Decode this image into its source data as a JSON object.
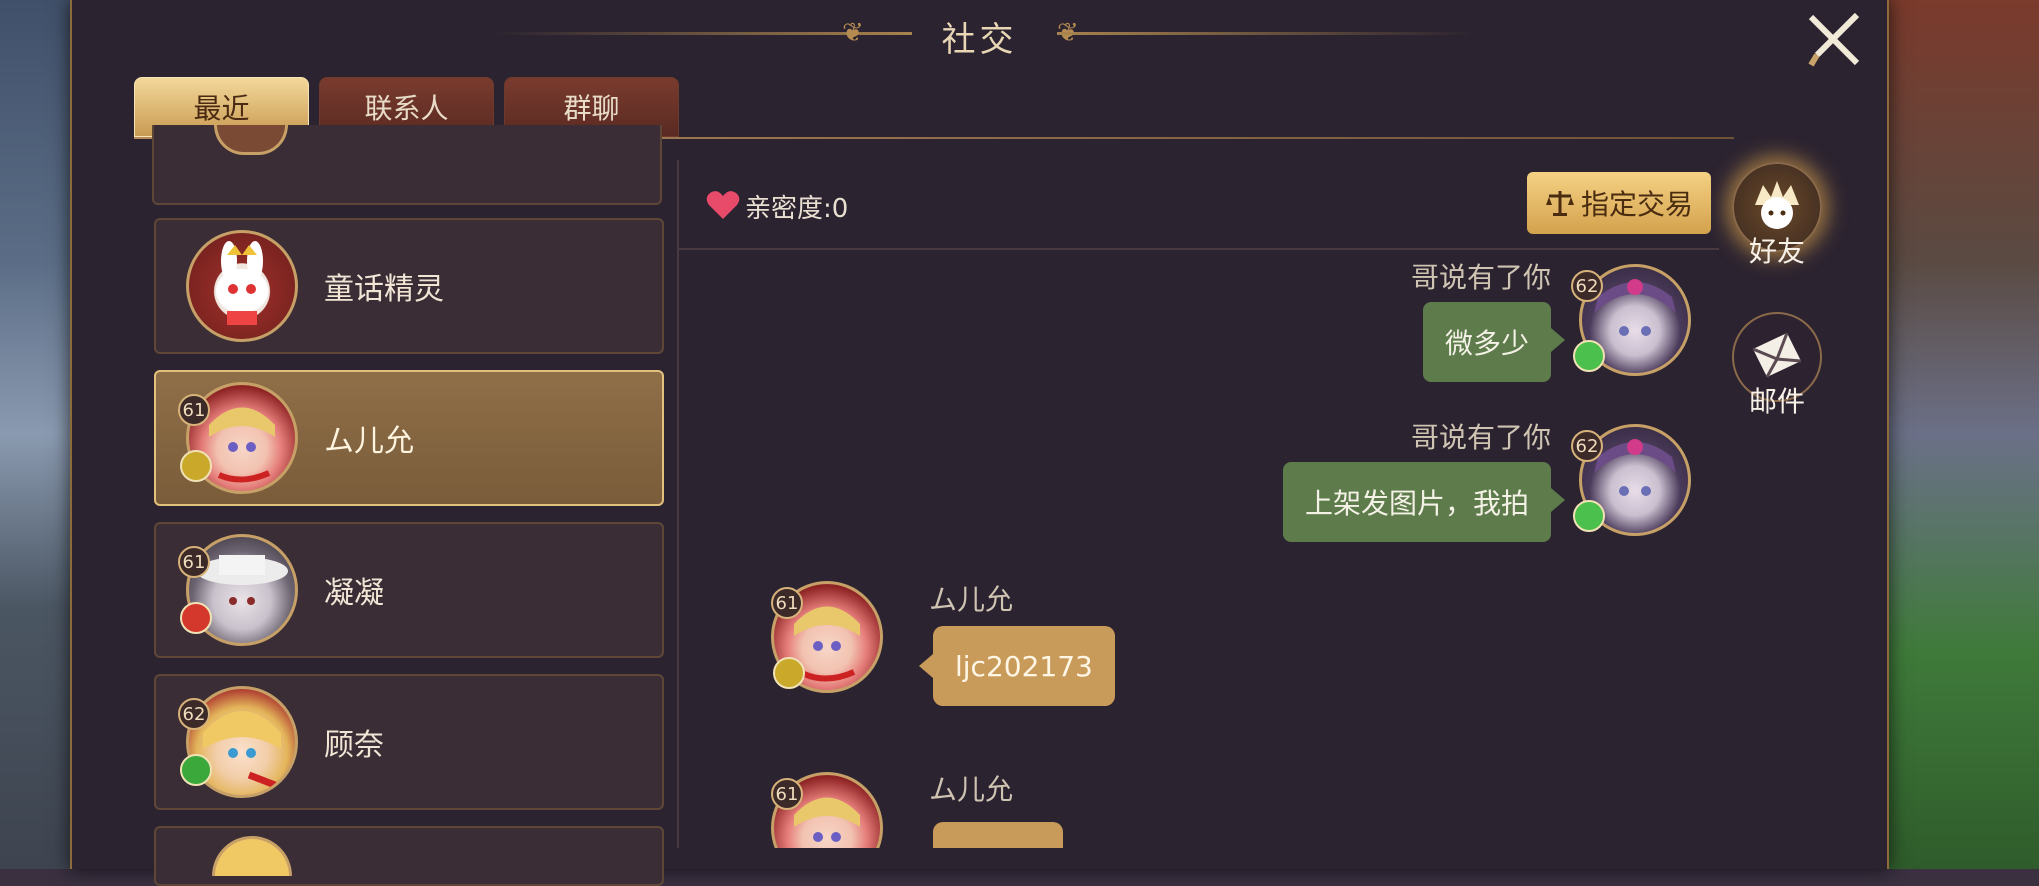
{
  "window": {
    "title": "社交"
  },
  "tabs": [
    {
      "label": "最近",
      "active": true
    },
    {
      "label": "联系人",
      "active": false
    },
    {
      "label": "群聊",
      "active": false
    }
  ],
  "contacts": [
    {
      "name": "",
      "level": "",
      "partial": true
    },
    {
      "name": "童话精灵",
      "level": ""
    },
    {
      "name": "ム儿允",
      "level": "61",
      "selected": true
    },
    {
      "name": "凝凝",
      "level": "61"
    },
    {
      "name": "顾奈",
      "level": "62"
    },
    {
      "name": "",
      "level": "",
      "partial": true
    }
  ],
  "chat": {
    "intimacy_label": "亲密度:0",
    "trade_button": "指定交易",
    "messages": [
      {
        "sender": "哥说有了你",
        "level": "62",
        "text": "微多少",
        "side": "right"
      },
      {
        "sender": "哥说有了你",
        "level": "62",
        "text": "上架发图片，我拍",
        "side": "right"
      },
      {
        "sender": "ム儿允",
        "level": "61",
        "text": "ljc202173",
        "side": "left"
      },
      {
        "sender": "ム儿允",
        "level": "61",
        "text": "",
        "side": "left"
      }
    ]
  },
  "side_nav": [
    {
      "label": "好友",
      "icon": "friend-icon",
      "active": true
    },
    {
      "label": "邮件",
      "icon": "mail-icon",
      "active": false
    }
  ],
  "colors": {
    "panel_bg": "#2b2330",
    "accent_gold": "#d7b27a",
    "bubble_self": "#5d7b4b",
    "bubble_other": "#c99b5a"
  }
}
